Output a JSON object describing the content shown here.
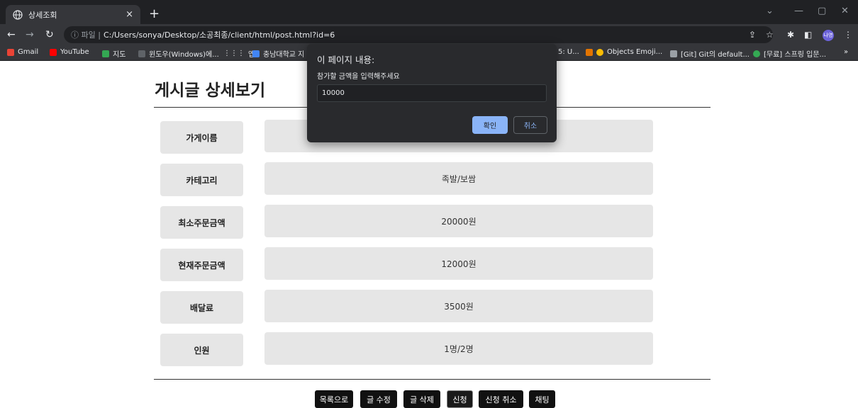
{
  "browser": {
    "tab_title": "상세조회",
    "tab_close": "×",
    "new_tab": "+",
    "url_prefix": "ⓘ 파일 |",
    "url": "C:/Users/sonya/Desktop/소공최종/client/html/post.html?id=6",
    "profile_badge": "나영"
  },
  "bookmarks": [
    {
      "label": "Gmail",
      "color": "#ea4335"
    },
    {
      "label": "YouTube",
      "color": "#ff0000"
    },
    {
      "label": "지도",
      "color": "#34a853"
    },
    {
      "label": "윈도우(Windows)에...",
      "color": "#5f6368"
    },
    {
      "label": "앱",
      "color": "#9aa0a6"
    },
    {
      "label": "충남대학교 지",
      "color": "#4285f4"
    },
    {
      "label": "5: U...",
      "color": "#5f6368"
    },
    {
      "label": "Objects Emoji...",
      "color": "#fbbc04"
    },
    {
      "label": "[Git] Git의 default...",
      "color": "#9aa0a6"
    },
    {
      "label": "[무료] 스프링 입문...",
      "color": "#34a853"
    },
    {
      "label": "»",
      "color": "transparent"
    }
  ],
  "page": {
    "title": "게시글 상세보기",
    "rows": [
      {
        "label": "가게이름",
        "value": ""
      },
      {
        "label": "카테고리",
        "value": "족발/보쌈"
      },
      {
        "label": "최소주문금액",
        "value": "20000원"
      },
      {
        "label": "현재주문금액",
        "value": "12000원"
      },
      {
        "label": "배달료",
        "value": "3500원"
      },
      {
        "label": "인원",
        "value": "1명/2명"
      }
    ],
    "buttons": [
      "목록으로",
      "글 수정",
      "글 삭제",
      "신청",
      "신청 취소",
      "채팅"
    ]
  },
  "dialog": {
    "title": "이 페이지 내용:",
    "message": "참가할 금액을 입력해주세요",
    "input_value": "10000",
    "ok_label": "확인",
    "cancel_label": "취소"
  }
}
